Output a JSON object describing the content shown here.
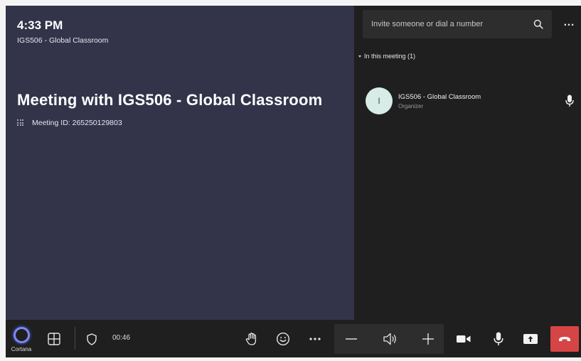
{
  "stage": {
    "clock": "4:33 PM",
    "clock_subtitle": "IGS506 - Global Classroom",
    "meeting_title": "Meeting with IGS506 - Global Classroom",
    "meeting_id": "Meeting ID: 265250129803"
  },
  "panel": {
    "invite_placeholder": "Invite someone or dial a number",
    "section_label": "In this meeting (1)",
    "participants": [
      {
        "initial": "I",
        "name": "IGS506 - Global Classroom",
        "role": "Organizer"
      }
    ]
  },
  "toolbar": {
    "cortana_label": "Cortana",
    "timer": "00:46"
  },
  "colors": {
    "stage_bg": "#33344a",
    "panel_bg": "#1f1f1f",
    "cortana_ring": "#7a88f8",
    "hangup": "#d64545",
    "avatar_bg": "#d7ece7"
  },
  "icons": [
    "search-icon",
    "more-icon",
    "dialpad-icon",
    "mic-icon",
    "grid-icon",
    "shield-icon",
    "raise-hand-icon",
    "emoji-icon",
    "volume-down-icon",
    "speaker-icon",
    "volume-up-icon",
    "camera-icon",
    "share-screen-icon",
    "hang-up-icon"
  ]
}
